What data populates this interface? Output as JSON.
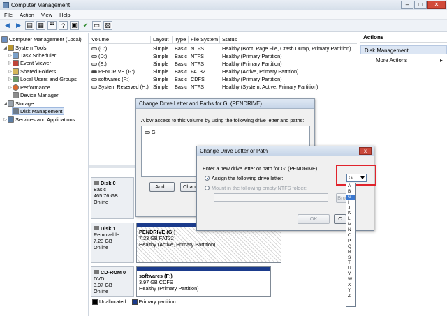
{
  "window": {
    "title": "Computer Management"
  },
  "menu": [
    "File",
    "Action",
    "View",
    "Help"
  ],
  "tree": {
    "root": "Computer Management (Local)",
    "system_tools": "System Tools",
    "task_scheduler": "Task Scheduler",
    "event_viewer": "Event Viewer",
    "shared_folders": "Shared Folders",
    "local_users": "Local Users and Groups",
    "performance": "Performance",
    "device_manager": "Device Manager",
    "storage": "Storage",
    "disk_management": "Disk Management",
    "services": "Services and Applications"
  },
  "volumes": {
    "headers": [
      "Volume",
      "Layout",
      "Type",
      "File System",
      "Status"
    ],
    "rows": [
      [
        "(C:)",
        "Simple",
        "Basic",
        "NTFS",
        "Healthy (Boot, Page File, Crash Dump, Primary Partition)"
      ],
      [
        "(D:)",
        "Simple",
        "Basic",
        "NTFS",
        "Healthy (Primary Partition)"
      ],
      [
        "(E:)",
        "Simple",
        "Basic",
        "NTFS",
        "Healthy (Primary Partition)"
      ],
      [
        "PENDRIVE (G:)",
        "Simple",
        "Basic",
        "FAT32",
        "Healthy (Active, Primary Partition)"
      ],
      [
        "softwares (F:)",
        "Simple",
        "Basic",
        "CDFS",
        "Healthy (Primary Partition)"
      ],
      [
        "System Reserved (H:)",
        "Simple",
        "Basic",
        "NTFS",
        "Healthy (System, Active, Primary Partition)"
      ]
    ]
  },
  "disks": {
    "disk0": {
      "name": "Disk 0",
      "type": "Basic",
      "size": "465.76 GB",
      "status": "Online"
    },
    "disk1": {
      "name": "Disk 1",
      "type": "Removable",
      "size": "7.23 GB",
      "status": "Online",
      "part_name": "PENDRIVE (G:)",
      "part_size": "7.23 GB FAT32",
      "part_status": "Healthy (Active, Primary Partition)"
    },
    "cdrom0": {
      "name": "CD-ROM 0",
      "type": "DVD",
      "size": "3.97 GB",
      "status": "Online",
      "part_name": "softwares (F:)",
      "part_size": "3.97 GB CDFS",
      "part_status": "Healthy (Primary Partition)"
    }
  },
  "legend": {
    "unallocated": "Unallocated",
    "primary": "Primary partition"
  },
  "actions": {
    "header": "Actions",
    "section": "Disk Management",
    "more": "More Actions"
  },
  "dialog1": {
    "title": "Change Drive Letter and Paths for G: (PENDRIVE)",
    "description": "Allow access to this volume by using the following drive letter and paths:",
    "entry": "G:",
    "add": "Add...",
    "change": "Chan"
  },
  "dialog2": {
    "title": "Change Drive Letter or Path",
    "prompt": "Enter a new drive letter or path for G: (PENDRIVE).",
    "assign": "Assign the following drive letter:",
    "mount": "Mount in the following empty NTFS folder:",
    "browse": "Bro",
    "ok": "OK",
    "cancel": "C",
    "close": "x"
  },
  "drive_letter": {
    "selected": "G",
    "options": [
      "A",
      "B",
      "G",
      "I",
      "J",
      "K",
      "L",
      "M",
      "N",
      "O",
      "P",
      "Q",
      "R",
      "S",
      "T",
      "U",
      "V",
      "W",
      "X",
      "Y",
      "Z"
    ]
  },
  "colors": {
    "primary_partition": "#1b3b8c",
    "highlight": "#e0242c",
    "selection": "#3b78d0"
  }
}
